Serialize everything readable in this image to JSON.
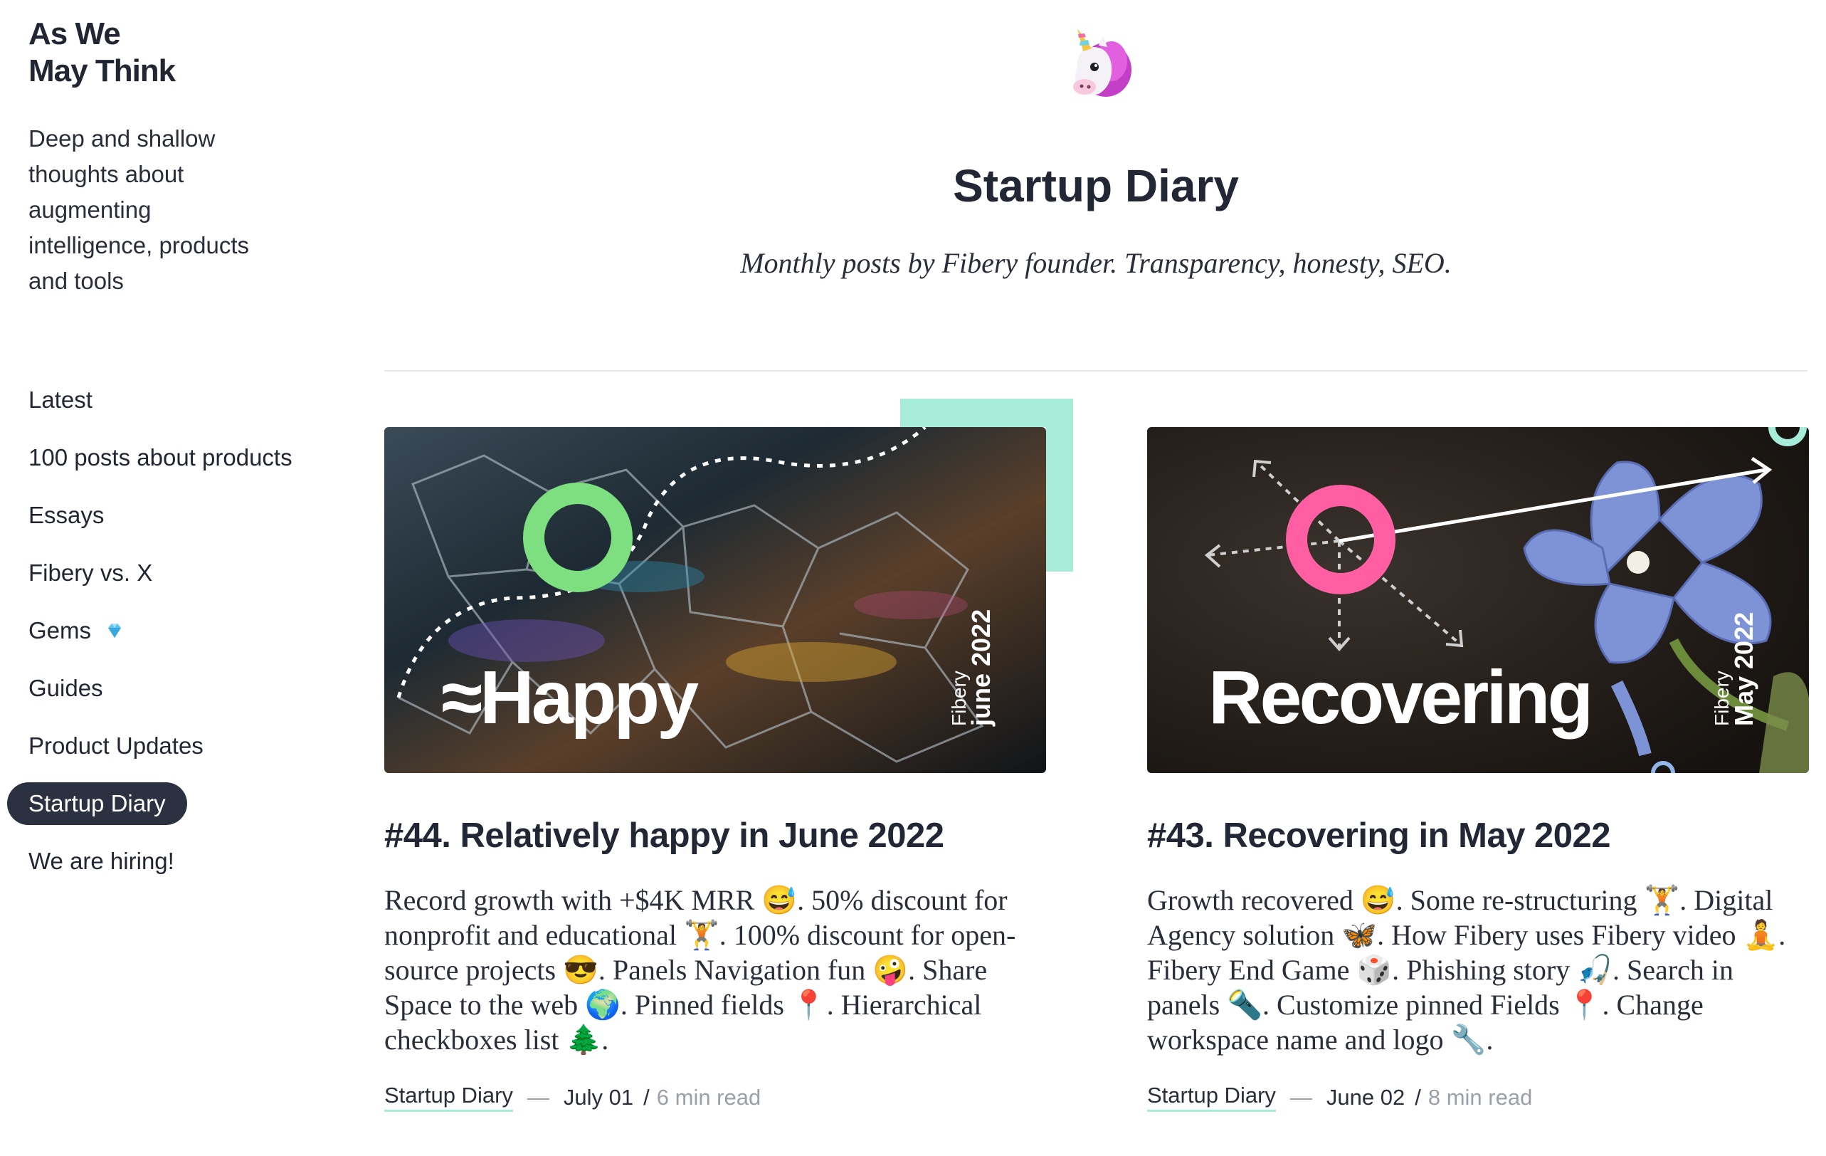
{
  "sidebar": {
    "brand_line1": "As We",
    "brand_line2": "May Think",
    "tagline": "Deep and shallow thoughts about augmenting intelligence, products and tools",
    "nav": [
      {
        "label": "Latest"
      },
      {
        "label": "100 posts about products"
      },
      {
        "label": "Essays"
      },
      {
        "label": "Fibery vs. X"
      },
      {
        "label": "Gems"
      },
      {
        "label": "Guides"
      },
      {
        "label": "Product Updates"
      },
      {
        "label": "Startup Diary",
        "active": true
      },
      {
        "label": "We are hiring!"
      }
    ]
  },
  "header": {
    "icon": "unicorn-icon",
    "title": "Startup Diary",
    "subtitle": "Monthly posts by Fibery founder. Transparency, honesty, SEO."
  },
  "posts": [
    {
      "image_word": "≈Happy",
      "image_brand": "Fibery",
      "image_month": "june 2022",
      "title": "#44. Relatively happy in June 2022",
      "excerpt": "Record growth with +$4K MRR 😅. 50% discount for nonprofit and educational 🏋. 100% discount for open-source projects 😎. Panels Navigation fun 🤪. Share Space to the web 🌍. Pinned fields 📍. Hierarchical checkboxes list 🌲.",
      "tag": "Startup Diary",
      "date": "July 01",
      "read_time": "6 min read"
    },
    {
      "image_word": "Recovering",
      "image_brand": "Fibery",
      "image_month": "May 2022",
      "title": "#43. Recovering in May 2022",
      "excerpt": "Growth recovered 😅. Some re-structuring 🏋. Digital Agency solution 🦋. How Fibery uses Fibery video 🧘. Fibery End Game 🎲. Phishing story 🎣. Search in panels 🔦. Customize pinned Fields 📍. Change workspace name and logo 🔧.",
      "tag": "Startup Diary",
      "date": "June 02",
      "read_time": "8 min read"
    }
  ],
  "colors": {
    "accent_mint": "#a6ecd8",
    "ring_green": "#7ddf7f",
    "ring_pink": "#ff5fa2",
    "nav_active_bg": "#2b3140"
  }
}
